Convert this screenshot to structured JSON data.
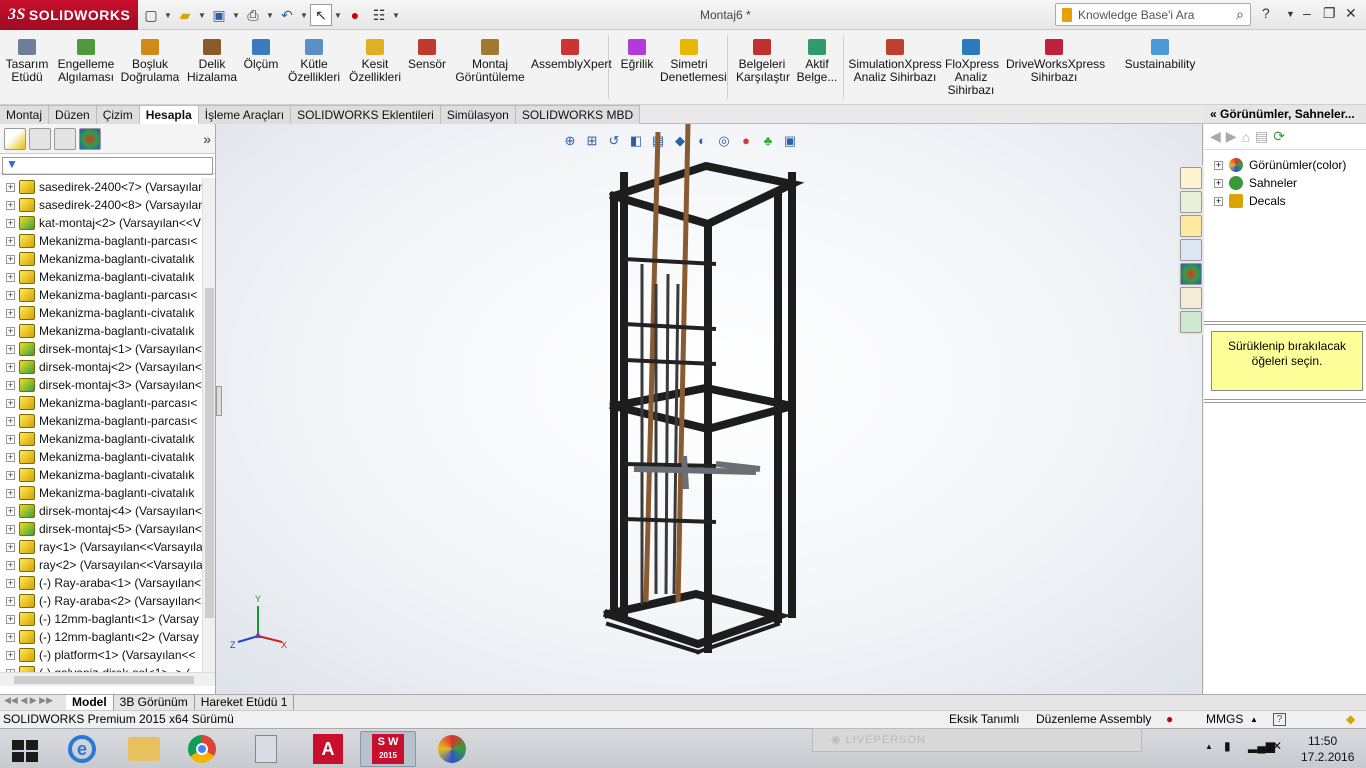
{
  "app": {
    "logo_text": "SOLIDWORKS",
    "logo_mark": "3S",
    "title": "Montaj6 *"
  },
  "search": {
    "placeholder": "Knowledge Base'i Ara"
  },
  "ribbon": [
    {
      "label": "Tasarım\nEtüdü",
      "icon": "design-study-icon",
      "color": "#6e7f99"
    },
    {
      "label": "Engelleme\nAlgılaması",
      "icon": "interference-icon",
      "color": "#4e9a3a"
    },
    {
      "label": "Boşluk\nDoğrulama",
      "icon": "clearance-icon",
      "color": "#d08a1a"
    },
    {
      "label": "Delik\nHizalama",
      "icon": "hole-align-icon",
      "color": "#8a5a2a"
    },
    {
      "label": "Ölçüm",
      "icon": "measure-icon",
      "color": "#3b7bbf"
    },
    {
      "label": "Kütle\nÖzellikleri",
      "icon": "mass-icon",
      "color": "#5a8fc7"
    },
    {
      "label": "Kesit\nÖzellikleri",
      "icon": "section-icon",
      "color": "#e0b020"
    },
    {
      "label": "Sensör",
      "icon": "sensor-icon",
      "color": "#c0392b"
    },
    {
      "label": "Montaj\nGörüntüleme",
      "icon": "assembly-view-icon",
      "color": "#a07a30"
    },
    {
      "label": "AssemblyXpert",
      "icon": "assemblyxpert-icon",
      "color": "#cc3333"
    },
    {
      "label": "Eğrilik",
      "icon": "curvature-icon",
      "color": "#b23ad8"
    },
    {
      "label": "Simetri\nDenetlemesi",
      "icon": "symmetry-icon",
      "color": "#e8b800"
    },
    {
      "label": "Belgeleri\nKarşılaştır",
      "icon": "compare-icon",
      "color": "#c03030"
    },
    {
      "label": "Aktif\nBelge...",
      "icon": "active-doc-icon",
      "color": "#2f9a6a"
    },
    {
      "label": "SimulationXpress\nAnaliz Sihirbazı",
      "icon": "simulation-icon",
      "color": "#c04030"
    },
    {
      "label": "FloXpress\nAnaliz\nSihirbazı",
      "icon": "floxpress-icon",
      "color": "#2a7ac0"
    },
    {
      "label": "DriveWorksXpress\nSihirbazı",
      "icon": "driveworks-icon",
      "color": "#c0203a"
    },
    {
      "label": "Sustainability",
      "icon": "sustainability-icon",
      "color": "#4a9ad8"
    }
  ],
  "tabs": [
    "Montaj",
    "Düzen",
    "Çizim",
    "Hesapla",
    "İşleme Araçları",
    "SOLIDWORKS Eklentileri",
    "Simülasyon",
    "SOLIDWORKS MBD"
  ],
  "active_tab": "Hesapla",
  "tree": [
    {
      "label": "sasedirek-2400<7> (Varsayılan",
      "g": false
    },
    {
      "label": "sasedirek-2400<8> (Varsayılan",
      "g": false
    },
    {
      "label": "kat-montaj<2> (Varsayılan<<V",
      "g": true
    },
    {
      "label": "Mekanizma-baglantı-parcası<",
      "g": false
    },
    {
      "label": "Mekanizma-baglantı-civatalık",
      "g": false
    },
    {
      "label": "Mekanizma-baglantı-civatalık",
      "g": false
    },
    {
      "label": "Mekanizma-baglantı-parcası<",
      "g": false
    },
    {
      "label": "Mekanizma-baglantı-civatalık",
      "g": false
    },
    {
      "label": "Mekanizma-baglantı-civatalık",
      "g": false
    },
    {
      "label": "dirsek-montaj<1> (Varsayılan<",
      "g": true
    },
    {
      "label": "dirsek-montaj<2> (Varsayılan<",
      "g": true
    },
    {
      "label": "dirsek-montaj<3> (Varsayılan<",
      "g": true
    },
    {
      "label": "Mekanizma-baglantı-parcası<",
      "g": false
    },
    {
      "label": "Mekanizma-baglantı-parcası<",
      "g": false
    },
    {
      "label": "Mekanizma-baglantı-civatalık",
      "g": false
    },
    {
      "label": "Mekanizma-baglantı-civatalık",
      "g": false
    },
    {
      "label": "Mekanizma-baglantı-civatalık",
      "g": false
    },
    {
      "label": "Mekanizma-baglantı-civatalık",
      "g": false
    },
    {
      "label": "dirsek-montaj<4> (Varsayılan<",
      "g": true
    },
    {
      "label": "dirsek-montaj<5> (Varsayılan<",
      "g": true
    },
    {
      "label": "ray<1> (Varsayılan<<Varsayıla",
      "g": false
    },
    {
      "label": "ray<2> (Varsayılan<<Varsayıla",
      "g": false
    },
    {
      "label": "(-) Ray-araba<1> (Varsayılan<",
      "g": false
    },
    {
      "label": "(-) Ray-araba<2> (Varsayılan<",
      "g": false
    },
    {
      "label": "(-) 12mm-baglantı<1> (Varsay",
      "g": false
    },
    {
      "label": "(-) 12mm-baglantı<2> (Varsay",
      "g": false
    },
    {
      "label": "(-) platform<1> (Varsayılan<<",
      "g": false
    },
    {
      "label": "(-) galvaniz-direk-sol<1> -> (",
      "g": false
    }
  ],
  "right_panel": {
    "title": "Görünümler, Sahneler...",
    "items": [
      "Görünümler(color)",
      "Sahneler",
      "Decals"
    ],
    "drop_text": "Sürüklenip bırakılacak öğeleri seçin."
  },
  "bottom_tabs": [
    "Model",
    "3B Görünüm",
    "Hareket Etüdü 1"
  ],
  "status": {
    "left": "SOLIDWORKS Premium 2015 x64 Sürümü",
    "defined": "Eksik Tanımlı",
    "mode": "Düzenleme Assembly",
    "units": "MMGS"
  },
  "taskbar": {
    "time": "11:50",
    "date": "17.2.2016",
    "notification": "LIVEPERSON",
    "sw_badge": "S W",
    "sw_year": "2015"
  },
  "triad": {
    "x": "X",
    "y": "Y",
    "z": "Z"
  }
}
